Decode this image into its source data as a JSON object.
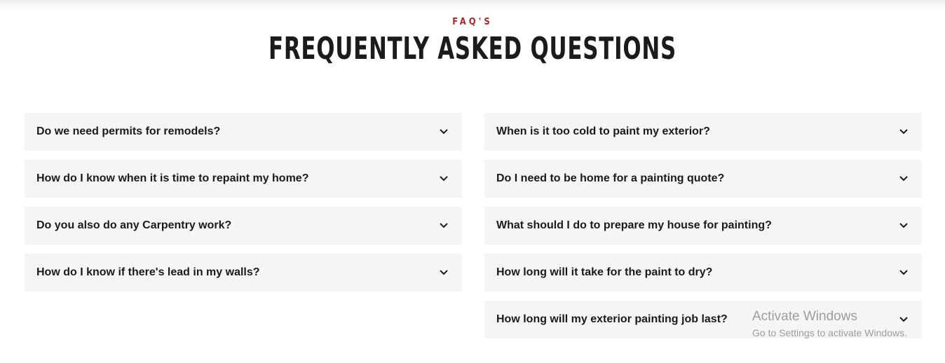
{
  "header": {
    "eyebrow": "FAQ'S",
    "title": "FREQUENTLY ASKED QUESTIONS"
  },
  "faq": {
    "left": [
      {
        "question": "Do we need permits for remodels?"
      },
      {
        "question": "How do I know when it is time to repaint my home?"
      },
      {
        "question": "Do you also do any Carpentry work?"
      },
      {
        "question": "How do I know if there's lead in my walls?"
      }
    ],
    "right": [
      {
        "question": "When is it too cold to paint my exterior?"
      },
      {
        "question": "Do I need to be home for a painting quote?"
      },
      {
        "question": "What should I do to prepare my house for painting?"
      },
      {
        "question": "How long will it take for the paint to dry?"
      },
      {
        "question": "How long will my exterior painting job last?"
      }
    ]
  },
  "watermark": {
    "line1": "Activate Windows",
    "line2": "Go to Settings to activate Windows."
  },
  "colors": {
    "accent": "#a52a2a",
    "heading": "#1b1b1b",
    "item_bg": "#f5f5f5"
  },
  "icons": {
    "expand": "chevron-down-icon"
  }
}
